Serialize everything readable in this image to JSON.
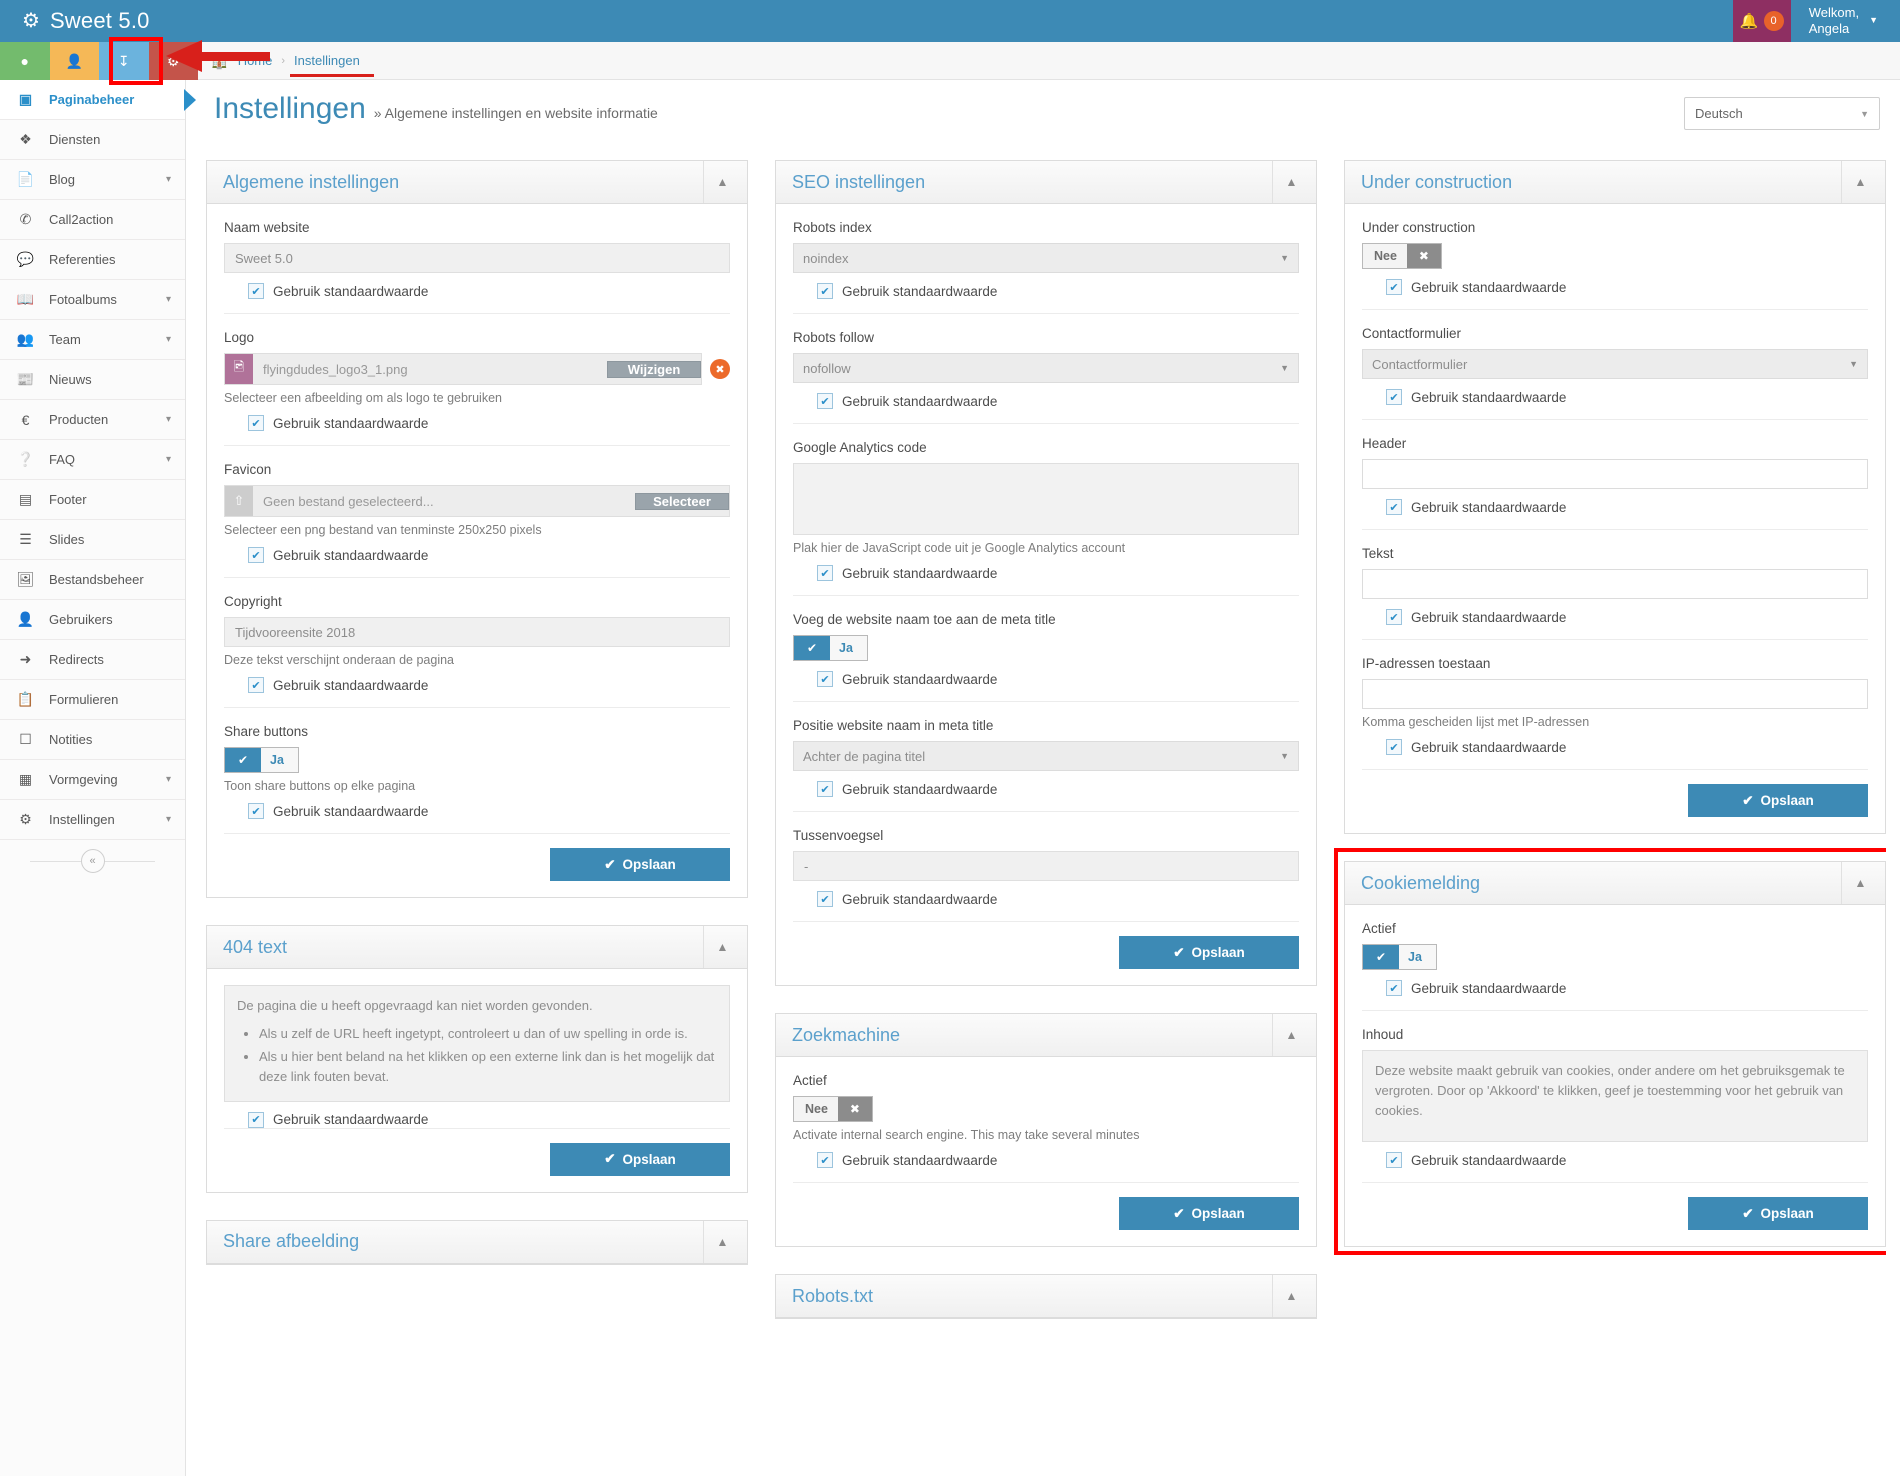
{
  "app": {
    "brand": "Sweet 5.0",
    "brand_icon": "gears-icon",
    "notification_count": "0",
    "welcome_line1": "Welkom,",
    "welcome_line2": "Angela"
  },
  "quick_buttons": [
    {
      "name": "location",
      "icon": "P",
      "color": "#73bb6d"
    },
    {
      "name": "user",
      "icon": "P",
      "color": "#f5b857"
    },
    {
      "name": "download",
      "icon": "P",
      "color": "#6bb3dd"
    },
    {
      "name": "settings",
      "icon": "P",
      "color": "#c4544a"
    }
  ],
  "breadcrumb": {
    "home": "Home",
    "separator": "›",
    "current": "Instellingen"
  },
  "page": {
    "title": "Instellingen",
    "subtitle": "» Algemene instellingen en website informatie",
    "language_value": "Deutsch"
  },
  "sidebar": {
    "items": [
      {
        "label": "Paginabeheer",
        "icon": "grid-icon",
        "active": true,
        "caret": false
      },
      {
        "label": "Diensten",
        "icon": "boxes-icon",
        "active": false,
        "caret": false
      },
      {
        "label": "Blog",
        "icon": "document-icon",
        "active": false,
        "caret": true
      },
      {
        "label": "Call2action",
        "icon": "phone-icon",
        "active": false,
        "caret": false
      },
      {
        "label": "Referenties",
        "icon": "comment-icon",
        "active": false,
        "caret": false
      },
      {
        "label": "Fotoalbums",
        "icon": "book-icon",
        "active": false,
        "caret": true
      },
      {
        "label": "Team",
        "icon": "users-icon",
        "active": false,
        "caret": true
      },
      {
        "label": "Nieuws",
        "icon": "newspaper-icon",
        "active": false,
        "caret": false
      },
      {
        "label": "Producten",
        "icon": "euro-icon",
        "active": false,
        "caret": true
      },
      {
        "label": "FAQ",
        "icon": "question-icon",
        "active": false,
        "caret": true
      },
      {
        "label": "Footer",
        "icon": "list-icon",
        "active": false,
        "caret": false
      },
      {
        "label": "Slides",
        "icon": "sliders-icon",
        "active": false,
        "caret": false
      },
      {
        "label": "Bestandsbeheer",
        "icon": "image-icon",
        "active": false,
        "caret": false
      },
      {
        "label": "Gebruikers",
        "icon": "person-icon",
        "active": false,
        "caret": false
      },
      {
        "label": "Redirects",
        "icon": "arrow-circle-icon",
        "active": false,
        "caret": false
      },
      {
        "label": "Formulieren",
        "icon": "form-icon",
        "active": false,
        "caret": false
      },
      {
        "label": "Notities",
        "icon": "note-icon",
        "active": false,
        "caret": false
      },
      {
        "label": "Vormgeving",
        "icon": "layout-icon",
        "active": false,
        "caret": true
      },
      {
        "label": "Instellingen",
        "icon": "gear-icon",
        "active": false,
        "caret": true
      }
    ],
    "collapse_icon": "«"
  },
  "common": {
    "use_default": "Gebruik standaardwaarde",
    "save": "Opslaan",
    "yes": "Ja",
    "no": "Nee"
  },
  "panels": {
    "general": {
      "title": "Algemene instellingen",
      "site_name_label": "Naam website",
      "site_name_value": "Sweet 5.0",
      "logo_label": "Logo",
      "logo_file": "flyingdudes_logo3_1.png",
      "logo_btn": "Wijzigen",
      "logo_help": "Selecteer een afbeelding om als logo te gebruiken",
      "favicon_label": "Favicon",
      "favicon_file": "Geen bestand geselecteerd...",
      "favicon_btn": "Selecteer",
      "favicon_help": "Selecteer een png bestand van tenminste 250x250 pixels",
      "copyright_label": "Copyright",
      "copyright_value": "Tijdvooreensite 2018",
      "copyright_help": "Deze tekst verschijnt onderaan de pagina",
      "share_label": "Share buttons",
      "share_toggle": "Ja",
      "share_help": "Toon share buttons op elke pagina"
    },
    "text404": {
      "title": "404 text",
      "intro": "De pagina die u heeft opgevraagd kan niet worden gevonden.",
      "bullets": [
        "Als u zelf de URL heeft ingetypt, controleert u dan of uw spelling in orde is.",
        "Als u hier bent beland na het klikken op een externe link dan is het mogelijk dat deze link fouten bevat."
      ]
    },
    "share_image": {
      "title": "Share afbeelding"
    },
    "seo": {
      "title": "SEO instellingen",
      "robots_index_label": "Robots index",
      "robots_index_value": "noindex",
      "robots_follow_label": "Robots follow",
      "robots_follow_value": "nofollow",
      "ga_label": "Google Analytics code",
      "ga_value": "",
      "ga_help": "Plak hier de JavaScript code uit je Google Analytics account",
      "meta_title_label": "Voeg de website naam toe aan de meta title",
      "meta_title_toggle": "Ja",
      "position_label": "Positie website naam in meta title",
      "position_value": "Achter de pagina titel",
      "separator_label": "Tussenvoegsel",
      "separator_value": "-"
    },
    "search": {
      "title": "Zoekmachine",
      "active_label": "Actief",
      "active_toggle": "Nee",
      "help": "Activate internal search engine. This may take several minutes"
    },
    "robots_txt": {
      "title": "Robots.txt"
    },
    "under_construction": {
      "title": "Under construction",
      "uc_label": "Under construction",
      "uc_toggle": "Nee",
      "contact_label": "Contactformulier",
      "contact_value": "Contactformulier",
      "header_label": "Header",
      "header_value": "",
      "text_label": "Tekst",
      "text_value": "",
      "ip_label": "IP-adressen toestaan",
      "ip_value": "",
      "ip_help": "Komma gescheiden lijst met IP-adressen"
    },
    "cookie": {
      "title": "Cookiemelding",
      "active_label": "Actief",
      "active_toggle": "Ja",
      "content_label": "Inhoud",
      "content_value": "Deze website maakt gebruik van cookies, onder andere om het gebruiksgemak te vergroten. Door op 'Akkoord' te klikken, geef je toestemming voor het gebruik van cookies."
    }
  }
}
